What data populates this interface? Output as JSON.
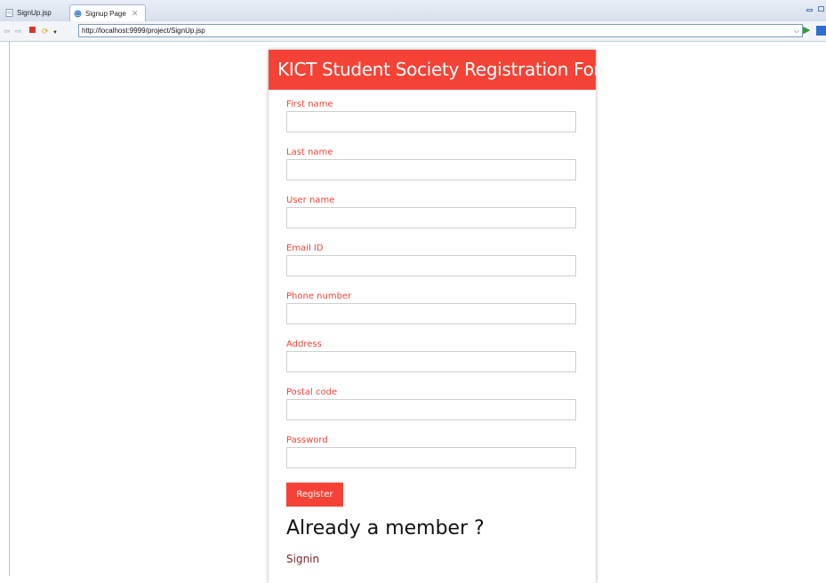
{
  "browser": {
    "tabs": [
      {
        "label": "SignUp.jsp",
        "icon": "file-icon",
        "active": false
      },
      {
        "label": "Signup Page",
        "icon": "globe-icon",
        "active": true,
        "close_glyph": "✕"
      }
    ],
    "url": "http://localhost:9999/project/SignUp.jsp"
  },
  "form": {
    "title": "KICT Student Society Registration Form",
    "fields": [
      {
        "label": "First name",
        "value": ""
      },
      {
        "label": "Last name",
        "value": ""
      },
      {
        "label": "User name",
        "value": ""
      },
      {
        "label": "Email ID",
        "value": ""
      },
      {
        "label": "Phone number",
        "value": ""
      },
      {
        "label": "Address",
        "value": ""
      },
      {
        "label": "Postal code",
        "value": ""
      },
      {
        "label": "Password",
        "value": ""
      }
    ],
    "submit_label": "Register",
    "member_heading": "Already a member ?",
    "signin_link": "Signin"
  },
  "colors": {
    "accent": "#f44336",
    "signin_link": "#7b1f1f"
  }
}
